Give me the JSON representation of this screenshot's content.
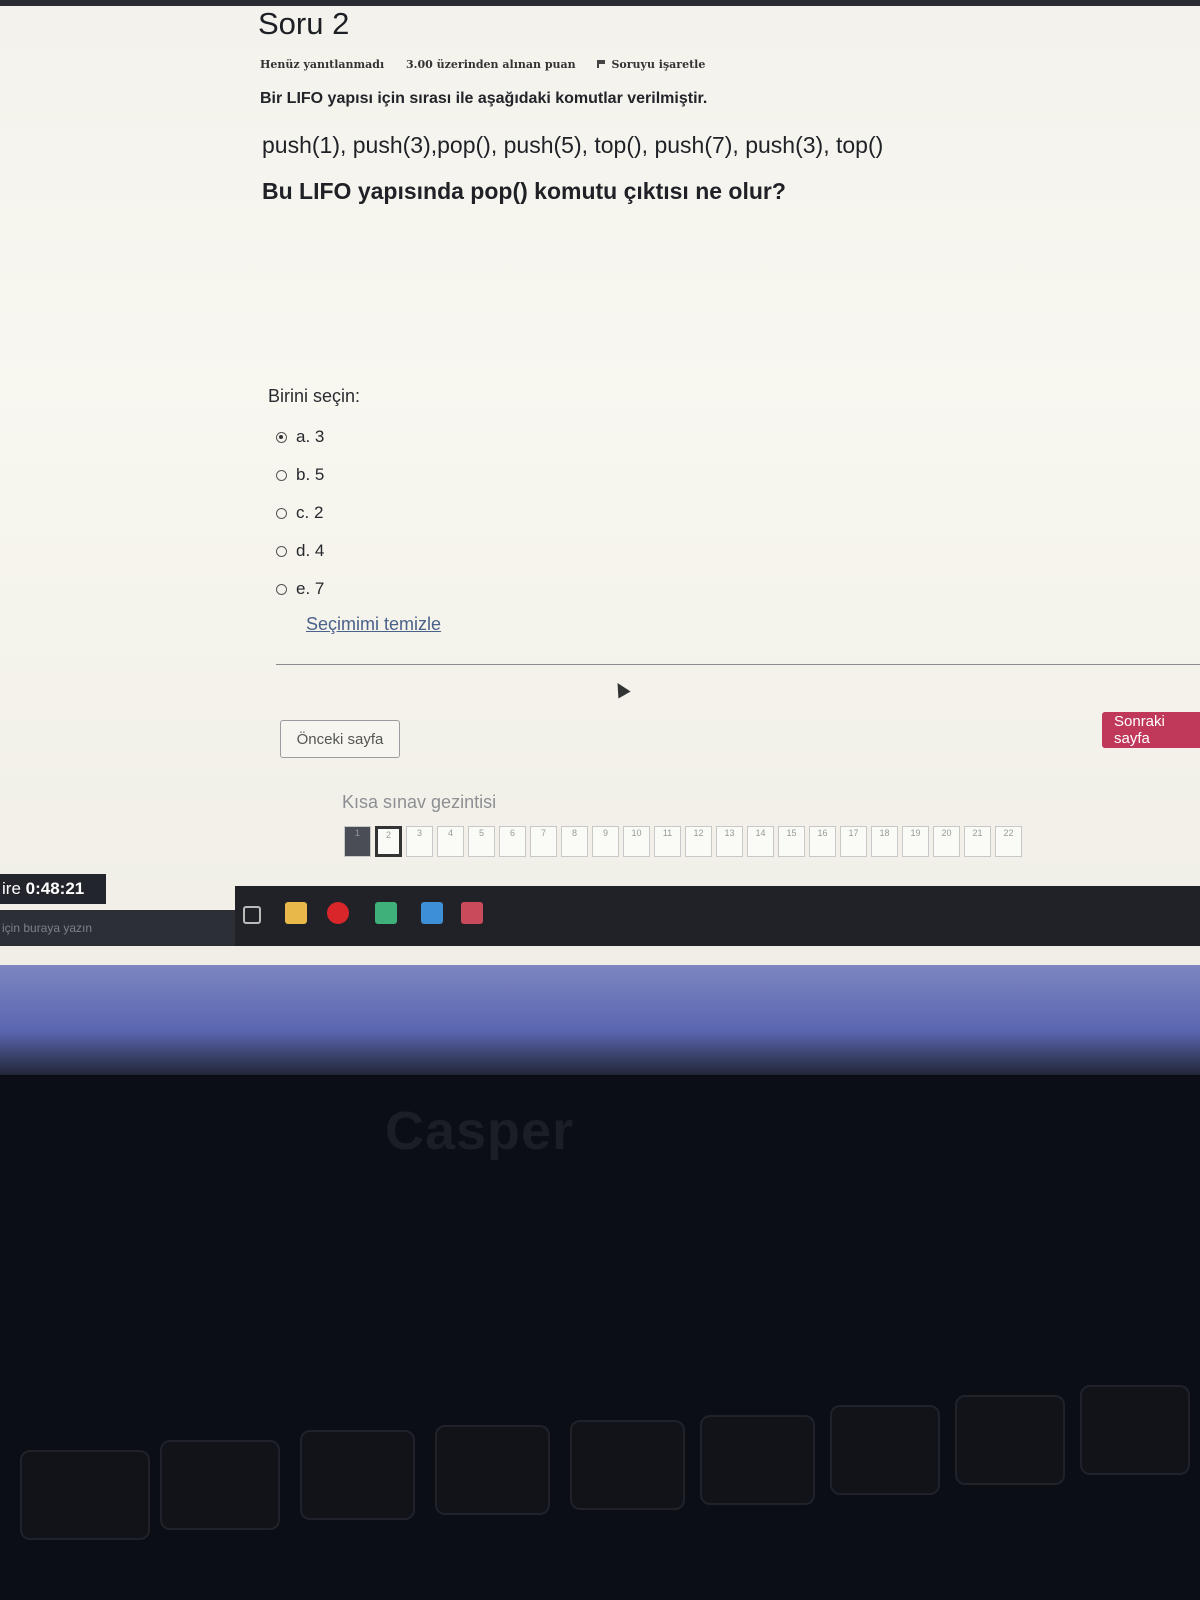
{
  "question": {
    "title": "Soru 2",
    "status": "Henüz yanıtlanmadı",
    "points": "3.00 üzerinden alınan puan",
    "flag_label": "Soruyu işaretle",
    "intro": "Bir LIFO yapısı için sırası ile aşağıdaki komutlar verilmiştir.",
    "commands": "push(1), push(3),pop(), push(5), top(), push(7), push(3), top()",
    "ask": "Bu LIFO yapısında pop() komutu çıktısı ne olur?"
  },
  "answers": {
    "prompt": "Birini seçin:",
    "options": [
      {
        "label": "a. 3",
        "selected": true
      },
      {
        "label": "b. 5",
        "selected": false
      },
      {
        "label": "c. 2",
        "selected": false
      },
      {
        "label": "d. 4",
        "selected": false
      },
      {
        "label": "e. 7",
        "selected": false
      }
    ],
    "clear_label": "Seçimimi temizle"
  },
  "nav": {
    "prev_label": "Önceki sayfa",
    "next_label": "Sonraki sayfa",
    "quiz_nav_title": "Kısa sınav gezintisi",
    "cells": [
      "1",
      "2",
      "3",
      "4",
      "5",
      "6",
      "7",
      "8",
      "9",
      "10",
      "11",
      "12",
      "13",
      "14",
      "15",
      "16",
      "17",
      "18",
      "19",
      "20",
      "21",
      "22"
    ]
  },
  "timer": {
    "label": "ire",
    "value": "0:48:21"
  },
  "taskbar": {
    "search_placeholder": "için buraya yazın"
  },
  "laptop_brand": "Casper",
  "colors": {
    "next_button": "#c0395a",
    "link": "#4a6188"
  }
}
